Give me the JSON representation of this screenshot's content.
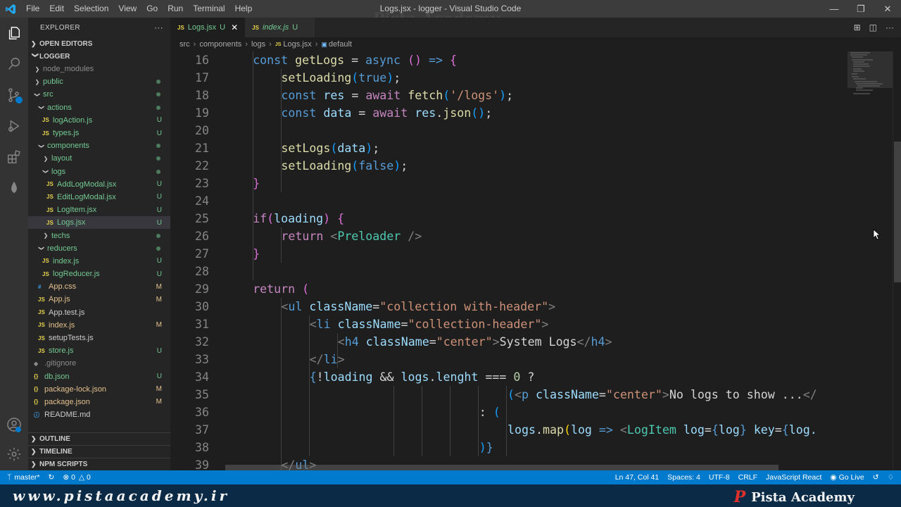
{
  "window": {
    "title": "Logs.jsx - logger - Visual Studio Code",
    "watermark": "Pista Academy",
    "menu": [
      "File",
      "Edit",
      "Selection",
      "View",
      "Go",
      "Run",
      "Terminal",
      "Help"
    ]
  },
  "explorer": {
    "title": "EXPLORER",
    "more": "···",
    "open_editors": "OPEN EDITORS",
    "project": "LOGGER",
    "tree": [
      {
        "label": "node_modules",
        "type": "folder",
        "depth": 1,
        "open": false,
        "status": "",
        "dot": true,
        "name": "node-modules"
      },
      {
        "label": "public",
        "type": "folder",
        "depth": 1,
        "open": false,
        "status": "",
        "dot": true,
        "name": "public"
      },
      {
        "label": "src",
        "type": "folder",
        "depth": 1,
        "open": true,
        "status": "",
        "dot": true,
        "name": "src"
      },
      {
        "label": "actions",
        "type": "folder",
        "depth": 2,
        "open": true,
        "status": "",
        "dot": true,
        "name": "actions"
      },
      {
        "label": "logAction.js",
        "type": "js",
        "depth": 3,
        "status": "U",
        "name": "logaction-js"
      },
      {
        "label": "types.js",
        "type": "js",
        "depth": 3,
        "status": "U",
        "name": "types-js"
      },
      {
        "label": "components",
        "type": "folder",
        "depth": 2,
        "open": true,
        "status": "",
        "dot": true,
        "name": "components"
      },
      {
        "label": "layout",
        "type": "folder",
        "depth": 3,
        "open": false,
        "status": "",
        "dot": true,
        "name": "layout"
      },
      {
        "label": "logs",
        "type": "folder",
        "depth": 3,
        "open": true,
        "status": "",
        "dot": true,
        "name": "logs"
      },
      {
        "label": "AddLogModal.jsx",
        "type": "jsx",
        "depth": 4,
        "status": "U",
        "name": "addlogmodal-jsx"
      },
      {
        "label": "EditLogModal.jsx",
        "type": "jsx",
        "depth": 4,
        "status": "U",
        "name": "editlogmodal-jsx"
      },
      {
        "label": "LogItem.jsx",
        "type": "jsx",
        "depth": 4,
        "status": "U",
        "name": "logitem-jsx"
      },
      {
        "label": "Logs.jsx",
        "type": "jsx",
        "depth": 4,
        "status": "U",
        "selected": true,
        "name": "logs-jsx"
      },
      {
        "label": "techs",
        "type": "folder",
        "depth": 3,
        "open": false,
        "status": "",
        "dot": true,
        "name": "techs"
      },
      {
        "label": "reducers",
        "type": "folder",
        "depth": 2,
        "open": true,
        "status": "",
        "dot": true,
        "name": "reducers"
      },
      {
        "label": "index.js",
        "type": "js",
        "depth": 3,
        "status": "U",
        "name": "reducers-index-js"
      },
      {
        "label": "logReducer.js",
        "type": "js",
        "depth": 3,
        "status": "U",
        "name": "logreducer-js"
      },
      {
        "label": "App.css",
        "type": "css",
        "depth": 2,
        "status": "M",
        "name": "app-css"
      },
      {
        "label": "App.js",
        "type": "js",
        "depth": 2,
        "status": "M",
        "name": "app-js"
      },
      {
        "label": "App.test.js",
        "type": "js",
        "depth": 2,
        "status": "",
        "name": "app-test-js"
      },
      {
        "label": "index.js",
        "type": "js",
        "depth": 2,
        "status": "M",
        "name": "src-index-js"
      },
      {
        "label": "setupTests.js",
        "type": "js",
        "depth": 2,
        "status": "",
        "name": "setuptests-js"
      },
      {
        "label": "store.js",
        "type": "js",
        "depth": 2,
        "status": "U",
        "name": "store-js"
      },
      {
        "label": ".gitignore",
        "type": "git",
        "depth": 1,
        "status": "",
        "name": "gitignore"
      },
      {
        "label": "db.json",
        "type": "json",
        "depth": 1,
        "status": "U",
        "name": "db-json"
      },
      {
        "label": "package-lock.json",
        "type": "json",
        "depth": 1,
        "status": "M",
        "name": "package-lock-json"
      },
      {
        "label": "package.json",
        "type": "json",
        "depth": 1,
        "status": "M",
        "name": "package-json"
      },
      {
        "label": "README.md",
        "type": "md",
        "depth": 1,
        "status": "",
        "name": "readme-md"
      }
    ],
    "bottom_sections": [
      "OUTLINE",
      "TIMELINE",
      "NPM SCRIPTS"
    ]
  },
  "tabs": [
    {
      "label": "Logs.jsx",
      "status": "U",
      "active": true
    },
    {
      "label": "index.js",
      "status": "U",
      "active": false
    }
  ],
  "breadcrumb": [
    "src",
    "components",
    "logs",
    "Logs.jsx",
    "default"
  ],
  "file_icon_text": {
    "js": "JS",
    "jsx": "JS",
    "css": "#",
    "json": "{}",
    "git": "◆",
    "md": "ⓘ"
  },
  "status_bar": {
    "branch": "master*",
    "errors": "0",
    "warnings": "0",
    "position": "Ln 47, Col 41",
    "spaces": "Spaces: 4",
    "encoding": "UTF-8",
    "eol": "CRLF",
    "language": "JavaScript React",
    "golive": "Go Live"
  },
  "footer": {
    "url": "www.pistaacademy.ir",
    "brand": "Pista Academy",
    "brand_mark": "P"
  },
  "colors": {
    "statusbar": "#007acc",
    "editor_bg": "#1e1e1e",
    "sidebar_bg": "#252526",
    "untracked": "#73c991",
    "modified": "#e2c08d"
  },
  "code": [
    {
      "n": 16,
      "indent": 1,
      "tokens": [
        [
          "s",
          "const "
        ],
        [
          "f",
          "getLogs"
        ],
        [
          "d",
          " = "
        ],
        [
          "s",
          "async "
        ],
        [
          "br2",
          "("
        ],
        [
          "br2",
          ")"
        ],
        [
          "s",
          " => "
        ],
        [
          "br2",
          "{"
        ]
      ]
    },
    {
      "n": 17,
      "indent": 2,
      "tokens": [
        [
          "f",
          "setLoading"
        ],
        [
          "br3",
          "("
        ],
        [
          "s",
          "true"
        ],
        [
          "br3",
          ")"
        ],
        [
          "d",
          ";"
        ]
      ]
    },
    {
      "n": 18,
      "indent": 2,
      "tokens": [
        [
          "s",
          "const "
        ],
        [
          "v",
          "res"
        ],
        [
          "d",
          " = "
        ],
        [
          "k",
          "await "
        ],
        [
          "f",
          "fetch"
        ],
        [
          "br3",
          "("
        ],
        [
          "str",
          "'/logs'"
        ],
        [
          "br3",
          ")"
        ],
        [
          "d",
          ";"
        ]
      ]
    },
    {
      "n": 19,
      "indent": 2,
      "tokens": [
        [
          "s",
          "const "
        ],
        [
          "v",
          "data"
        ],
        [
          "d",
          " = "
        ],
        [
          "k",
          "await "
        ],
        [
          "v",
          "res"
        ],
        [
          "d",
          "."
        ],
        [
          "f",
          "json"
        ],
        [
          "br3",
          "("
        ],
        [
          "br3",
          ")"
        ],
        [
          "d",
          ";"
        ]
      ]
    },
    {
      "n": 20,
      "indent": 0,
      "tokens": []
    },
    {
      "n": 21,
      "indent": 2,
      "tokens": [
        [
          "f",
          "setLogs"
        ],
        [
          "br3",
          "("
        ],
        [
          "v",
          "data"
        ],
        [
          "br3",
          ")"
        ],
        [
          "d",
          ";"
        ]
      ]
    },
    {
      "n": 22,
      "indent": 2,
      "tokens": [
        [
          "f",
          "setLoading"
        ],
        [
          "br3",
          "("
        ],
        [
          "s",
          "false"
        ],
        [
          "br3",
          ")"
        ],
        [
          "d",
          ";"
        ]
      ]
    },
    {
      "n": 23,
      "indent": 1,
      "tokens": [
        [
          "br2",
          "}"
        ]
      ]
    },
    {
      "n": 24,
      "indent": 0,
      "tokens": []
    },
    {
      "n": 25,
      "indent": 1,
      "tokens": [
        [
          "k",
          "if"
        ],
        [
          "br2",
          "("
        ],
        [
          "v",
          "loading"
        ],
        [
          "br2",
          ")"
        ],
        [
          "d",
          " "
        ],
        [
          "br2",
          "{"
        ]
      ]
    },
    {
      "n": 26,
      "indent": 2,
      "tokens": [
        [
          "k",
          "return "
        ],
        [
          "pu",
          "<"
        ],
        [
          "cp",
          "Preloader"
        ],
        [
          "d",
          " "
        ],
        [
          "pu",
          "/>"
        ]
      ]
    },
    {
      "n": 27,
      "indent": 1,
      "tokens": [
        [
          "br2",
          "}"
        ]
      ]
    },
    {
      "n": 28,
      "indent": 0,
      "tokens": []
    },
    {
      "n": 29,
      "indent": 1,
      "tokens": [
        [
          "k",
          "return "
        ],
        [
          "br2",
          "("
        ]
      ]
    },
    {
      "n": 30,
      "indent": 2,
      "tokens": [
        [
          "pu",
          "<"
        ],
        [
          "tg",
          "ul"
        ],
        [
          "d",
          " "
        ],
        [
          "at",
          "className"
        ],
        [
          "d",
          "="
        ],
        [
          "str",
          "\"collection with-header\""
        ],
        [
          "pu",
          ">"
        ]
      ]
    },
    {
      "n": 31,
      "indent": 3,
      "tokens": [
        [
          "pu",
          "<"
        ],
        [
          "tg",
          "li"
        ],
        [
          "d",
          " "
        ],
        [
          "at",
          "className"
        ],
        [
          "d",
          "="
        ],
        [
          "str",
          "\"collection-header\""
        ],
        [
          "pu",
          ">"
        ]
      ]
    },
    {
      "n": 32,
      "indent": 4,
      "tokens": [
        [
          "pu",
          "<"
        ],
        [
          "tg",
          "h4"
        ],
        [
          "d",
          " "
        ],
        [
          "at",
          "className"
        ],
        [
          "d",
          "="
        ],
        [
          "str",
          "\"center\""
        ],
        [
          "pu",
          ">"
        ],
        [
          "d",
          "System Logs"
        ],
        [
          "pu",
          "</"
        ],
        [
          "tg",
          "h4"
        ],
        [
          "pu",
          ">"
        ]
      ]
    },
    {
      "n": 33,
      "indent": 3,
      "tokens": [
        [
          "pu",
          "</"
        ],
        [
          "tg",
          "li"
        ],
        [
          "pu",
          ">"
        ]
      ]
    },
    {
      "n": 34,
      "indent": 3,
      "tokens": [
        [
          "s",
          "{"
        ],
        [
          "d",
          "!"
        ],
        [
          "v",
          "loading"
        ],
        [
          "d",
          " && "
        ],
        [
          "v",
          "logs"
        ],
        [
          "d",
          "."
        ],
        [
          "v",
          "lenght"
        ],
        [
          "d",
          " === "
        ],
        [
          "num",
          "0"
        ],
        [
          "d",
          " ?"
        ]
      ]
    },
    {
      "n": 35,
      "indent": 0,
      "pad": 40,
      "tokens": [
        [
          "br3",
          "("
        ],
        [
          "pu",
          "<"
        ],
        [
          "tg",
          "p"
        ],
        [
          "d",
          " "
        ],
        [
          "at",
          "className"
        ],
        [
          "d",
          "="
        ],
        [
          "str",
          "\"center\""
        ],
        [
          "pu",
          ">"
        ],
        [
          "d",
          "No logs to show ..."
        ],
        [
          "pu",
          "</"
        ]
      ]
    },
    {
      "n": 36,
      "indent": 0,
      "pad": 36,
      "tokens": [
        [
          "d",
          ": "
        ],
        [
          "br3",
          "("
        ]
      ]
    },
    {
      "n": 37,
      "indent": 0,
      "pad": 40,
      "tokens": [
        [
          "v",
          "logs"
        ],
        [
          "d",
          "."
        ],
        [
          "f",
          "map"
        ],
        [
          "br1",
          "("
        ],
        [
          "v",
          "log"
        ],
        [
          "s",
          " => "
        ],
        [
          "pu",
          "<"
        ],
        [
          "cp",
          "LogItem"
        ],
        [
          "d",
          " "
        ],
        [
          "at",
          "log"
        ],
        [
          "d",
          "="
        ],
        [
          "s",
          "{"
        ],
        [
          "v",
          "log"
        ],
        [
          "s",
          "}"
        ],
        [
          "d",
          " "
        ],
        [
          "at",
          "key"
        ],
        [
          "d",
          "="
        ],
        [
          "s",
          "{"
        ],
        [
          "v",
          "log."
        ]
      ]
    },
    {
      "n": 38,
      "indent": 0,
      "pad": 36,
      "tokens": [
        [
          "br3",
          ")"
        ],
        [
          "s",
          "}"
        ]
      ]
    },
    {
      "n": 39,
      "indent": 2,
      "tokens": [
        [
          "pu",
          "</"
        ],
        [
          "tg",
          "ul"
        ],
        [
          "pu",
          ">"
        ]
      ]
    }
  ]
}
